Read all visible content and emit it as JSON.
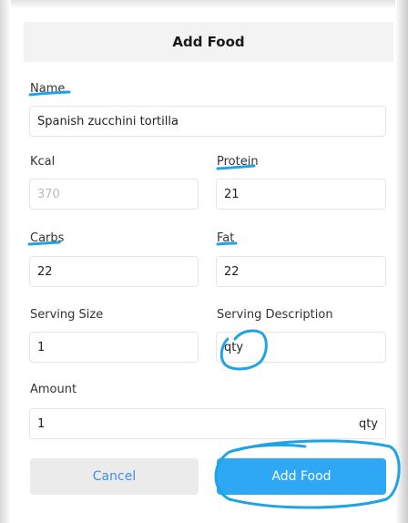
{
  "dialog": {
    "title": "Add Food"
  },
  "form": {
    "name_label": "Name",
    "name_value": "Spanish zucchini tortilla",
    "kcal_label": "Kcal",
    "kcal_placeholder": "370",
    "protein_label": "Protein",
    "protein_value": "21",
    "carbs_label": "Carbs",
    "carbs_value": "22",
    "fat_label": "Fat",
    "fat_value": "22",
    "serving_size_label": "Serving Size",
    "serving_size_value": "1",
    "serving_desc_label": "Serving Description",
    "serving_desc_value": "qty",
    "amount_label": "Amount",
    "amount_value": "1",
    "amount_unit": "qty"
  },
  "buttons": {
    "cancel_label": "Cancel",
    "add_label": "Add Food"
  },
  "annotation_color": "#1ea3e6"
}
